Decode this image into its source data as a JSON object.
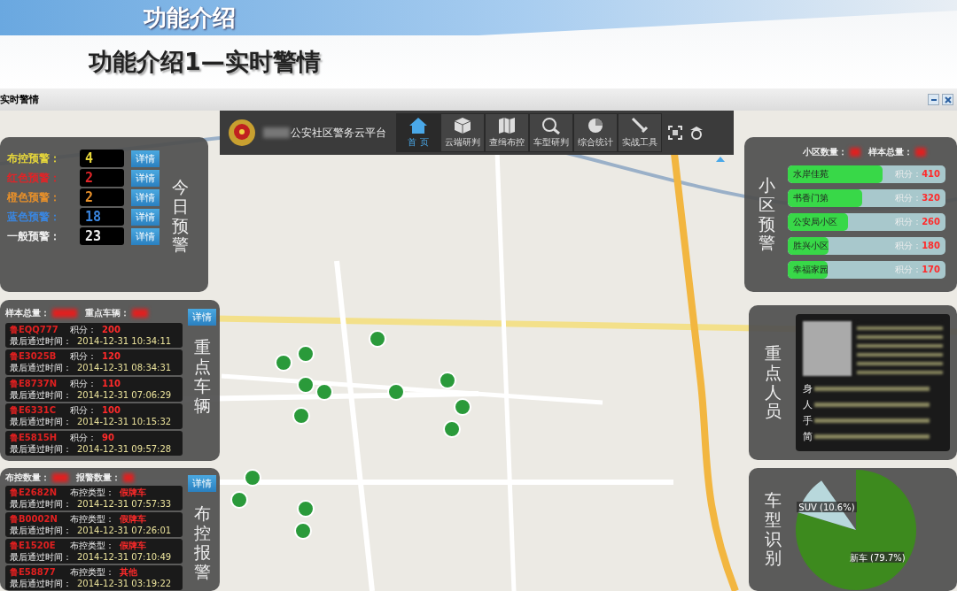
{
  "slide": {
    "heading": "功能介绍",
    "subtitle": "功能介绍1—实时警情"
  },
  "window": {
    "title": "实时警情"
  },
  "nav": {
    "title": "公安社区警务云平台",
    "items": [
      {
        "label": "首 页",
        "selected": true
      },
      {
        "label": "云端研判",
        "selected": false
      },
      {
        "label": "查缉布控",
        "selected": false
      },
      {
        "label": "车型研判",
        "selected": false
      },
      {
        "label": "综合统计",
        "selected": false
      },
      {
        "label": "实战工具",
        "selected": false
      }
    ]
  },
  "today_alerts": {
    "title": "今日预警",
    "rows": [
      {
        "label": "布控预警：",
        "value": "4",
        "color": "#e8d83a",
        "button": "详情"
      },
      {
        "label": "红色预警：",
        "value": "2",
        "color": "#e02428",
        "button": "详情"
      },
      {
        "label": "橙色预警：",
        "value": "2",
        "color": "#e8902a",
        "button": "详情"
      },
      {
        "label": "蓝色预警：",
        "value": "18",
        "color": "#3a86e0",
        "button": "详情"
      },
      {
        "label": "一般预警：",
        "value": "23",
        "color": "#f0f0f0",
        "button": "详情"
      }
    ]
  },
  "key_vehicles": {
    "title": "重点车辆",
    "summary": [
      "样本总量：",
      "重点车辆："
    ],
    "button": "详情",
    "rows": [
      {
        "plate": "鲁EQQ777",
        "score_label": "积分：",
        "score": "200",
        "time_label": "最后通过时间：",
        "time": "2014-12-31 10:34:11"
      },
      {
        "plate": "鲁E3025B",
        "score_label": "积分：",
        "score": "120",
        "time_label": "最后通过时间：",
        "time": "2014-12-31 08:34:31"
      },
      {
        "plate": "鲁E8737N",
        "score_label": "积分：",
        "score": "110",
        "time_label": "最后通过时间：",
        "time": "2014-12-31 07:06:29"
      },
      {
        "plate": "鲁E6331C",
        "score_label": "积分：",
        "score": "100",
        "time_label": "最后通过时间：",
        "time": "2014-12-31 10:15:32"
      },
      {
        "plate": "鲁E5815H",
        "score_label": "积分：",
        "score": "90",
        "time_label": "最后通过时间：",
        "time": "2014-12-31 09:57:28"
      }
    ]
  },
  "control_alerts": {
    "title": "布控报警",
    "summary": [
      "布控数量：",
      "报警数量："
    ],
    "button": "详情",
    "rows": [
      {
        "plate": "鲁E2682N",
        "type_label": "布控类型：",
        "type": "假牌车",
        "time_label": "最后通过时间：",
        "time": "2014-12-31 07:57:33"
      },
      {
        "plate": "鲁B0002N",
        "type_label": "布控类型：",
        "type": "假牌车",
        "time_label": "最后通过时间：",
        "time": "2014-12-31 07:26:01"
      },
      {
        "plate": "鲁E1520E",
        "type_label": "布控类型：",
        "type": "假牌车",
        "time_label": "最后通过时间：",
        "time": "2014-12-31 07:10:49"
      },
      {
        "plate": "鲁E58877",
        "type_label": "布控类型：",
        "type": "其他",
        "time_label": "最后通过时间：",
        "time": "2014-12-31 03:19:22"
      }
    ]
  },
  "community_alerts": {
    "title": "小区预警",
    "summary": [
      "小区数量：",
      "样本总量："
    ],
    "rows": [
      {
        "name": "水岸佳苑",
        "level": 0.6,
        "score_label": "积分：",
        "score": "410"
      },
      {
        "name": "书香门第",
        "level": 0.47,
        "score_label": "积分：",
        "score": "320"
      },
      {
        "name": "公安局小区",
        "level": 0.38,
        "score_label": "积分：",
        "score": "260"
      },
      {
        "name": "胜兴小区",
        "level": 0.26,
        "score_label": "积分：",
        "score": "180"
      },
      {
        "name": "幸福家园",
        "level": 0.25,
        "score_label": "积分：",
        "score": "170"
      }
    ]
  },
  "key_persons": {
    "title": "重点人员",
    "field_labels": [
      "身",
      "人",
      "手",
      "简"
    ]
  },
  "vehicle_types": {
    "title": "车型识别",
    "chart_data": {
      "type": "pie",
      "categories": [
        "新车 (79.7%)",
        "SUV (10.6%)"
      ],
      "values": [
        79.7,
        10.6
      ]
    }
  }
}
